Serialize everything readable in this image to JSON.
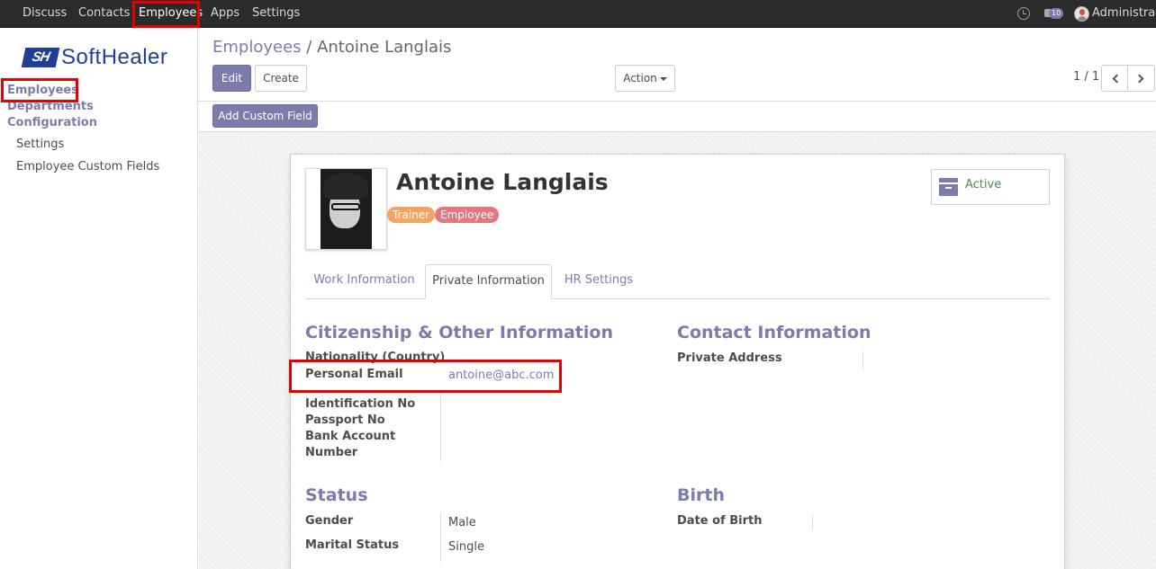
{
  "topbar": {
    "menu": [
      "Discuss",
      "Contacts",
      "Employees",
      "Apps",
      "Settings"
    ],
    "active_menu": "Employees",
    "message_count": "10",
    "user_name": "Administrator"
  },
  "sidebar": {
    "brand_mark": "SH",
    "brand_name": "SoftHealer",
    "links": [
      "Employees",
      "Departments",
      "Configuration"
    ],
    "sub_links": [
      "Settings",
      "Employee Custom Fields"
    ]
  },
  "control_panel": {
    "breadcrumb_root": "Employees",
    "breadcrumb_sep": "/",
    "breadcrumb_current": "Antoine Langlais",
    "edit_label": "Edit",
    "create_label": "Create",
    "action_label": "Action",
    "pager": "1 / 1",
    "add_custom_field_label": "Add Custom Field"
  },
  "employee": {
    "name": "Antoine Langlais",
    "tags": [
      {
        "label": "Trainer",
        "color": "#f4a460"
      },
      {
        "label": "Employee",
        "color": "#e8747c"
      }
    ],
    "status_button": "Active"
  },
  "tabs": [
    "Work Information",
    "Private Information",
    "HR Settings"
  ],
  "active_tab": "Private Information",
  "sections": {
    "citizenship": {
      "title": "Citizenship & Other Information",
      "nationality_label": "Nationality (Country)",
      "personal_email_label": "Personal Email",
      "personal_email_value": "antoine@abc.com",
      "identification_label": "Identification No",
      "passport_label": "Passport No",
      "bank_account_label_1": "Bank Account",
      "bank_account_label_2": "Number"
    },
    "contact": {
      "title": "Contact Information",
      "private_address_label": "Private Address"
    },
    "status": {
      "title": "Status",
      "gender_label": "Gender",
      "gender_value": "Male",
      "marital_label": "Marital Status",
      "marital_value": "Single"
    },
    "birth": {
      "title": "Birth",
      "dob_label": "Date of Birth"
    }
  },
  "colors": {
    "accent": "#7c7bad",
    "highlight": "#e60000",
    "navbar": "#2b2b2b"
  }
}
